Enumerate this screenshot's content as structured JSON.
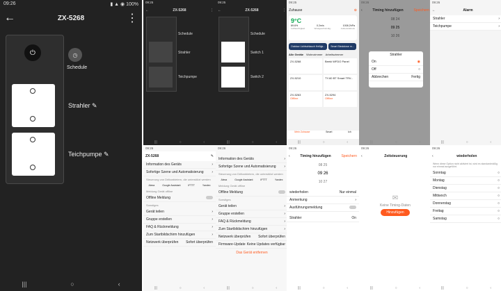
{
  "big": {
    "time": "09:26",
    "title": "ZX-5268",
    "schedule": "Schedule",
    "switch1": "Strahler",
    "switch2": "Teichpumpe"
  },
  "p1": {
    "time": "09:25",
    "title": "ZX-5268",
    "schedule": "Schedule",
    "s1": "Strahler",
    "s2": "Teichpumpe"
  },
  "p2": {
    "time": "09:25",
    "title": "ZX-5268",
    "schedule": "Schedule",
    "s1": "Switch 1",
    "s2": "Switch 2"
  },
  "p3": {
    "time": "09:25",
    "home": "Zuhause",
    "temp": "9°C",
    "hum": "69.6%",
    "hum_l": "Luftfeuchtigkeit",
    "pm": "0.2m/s",
    "pm_l": "Windgeschwindig..",
    "pr": "1008.2hPa",
    "pr_l": "Außenluftdruck",
    "scene1": "Outdoor Lichtschlauch Helligk...",
    "scene2": "Smart Steckdose m...",
    "tabs": [
      "Alle Geräte",
      "Wohnzimmer",
      "Arbeitszimmer"
    ],
    "devices": [
      "ZX-5268",
      "Beeki WFDO Panel",
      "ZX-5210",
      "TY-60 BT Smart TRV...",
      "ZX-5263",
      "ZX-5294"
    ],
    "offline": "Offline",
    "nav": [
      "Mein Zuhause",
      "Smart",
      "Ich"
    ]
  },
  "p4": {
    "time": "09:26",
    "title": "Timing hinzufügen",
    "save": "Speichern",
    "times": [
      "08 24",
      "09 25",
      "10 26"
    ],
    "dlg": "Strahler",
    "on": "On",
    "off": "Off",
    "cancel": "Abbrechen",
    "done": "Fertig"
  },
  "p5": {
    "time": "09:26",
    "title": "Alarm",
    "items": [
      "Strahler",
      "Teichpumpe"
    ]
  },
  "p6": {
    "time": "09:26",
    "title": "ZX-5268",
    "i1": "Information des Geräts",
    "i2": "Sofortige Szene und Automatisierung",
    "third": "Steuerung von Drittanbietern, die unterstützt werden",
    "tp": [
      "Alexa",
      "Google Assistant",
      "IFTTT",
      "Yandex"
    ],
    "off_l": "Meldung Gerät offline",
    "off": "Offline Meldung",
    "sonst": "Sonstiges",
    "rows": [
      "Gerät teilen",
      "Gruppe erstellen",
      "FAQ & Rückmeldung",
      "Zum Startbildschirm hinzufügen",
      "Netzwerk überprüfen"
    ],
    "check": "Sofort überprüfen"
  },
  "p7": {
    "time": "09:26",
    "i1": "Information des Geräts",
    "i2": "Sofortige Szene und Automatisierung",
    "third": "Steuerung von Drittanbietern, die unterstützt werden",
    "tp": [
      "Alexa",
      "Google Assistant",
      "IFTTT",
      "Yandex"
    ],
    "off_l": "Meldung Gerät offline",
    "off": "Offline Meldung",
    "sonst": "Sonstiges",
    "rows": [
      "Gerät teilen",
      "Gruppe erstellen",
      "FAQ & Rückmeldung",
      "Zum Startbildschirm hinzufügen",
      "Netzwerk überprüfen",
      "Firmware-Update"
    ],
    "check": "Sofort überprüfen",
    "fw": "Keine Updates verfügbar",
    "remove": "Das Gerät entfernen"
  },
  "p8": {
    "time": "09:26",
    "title": "Timing hinzufügen",
    "save": "Speichern",
    "times": [
      "08 25",
      "09 26",
      "10 27"
    ],
    "rep": "wiederholen",
    "rep_v": "Nur einmal",
    "note": "Anmerkung",
    "ausf": "Ausführungsmeldung",
    "strahler": "Strahler",
    "on": "On"
  },
  "p9": {
    "time": "09:26",
    "title": "Zeitsteuerung",
    "empty": "Keine Timing-Daten",
    "add": "Hinzufügen"
  },
  "p10": {
    "time": "09:26",
    "title": "wiederholen",
    "hint": "Wenn diese Option nicht aktiviert ist, wird es standardmäßig nur einmal ausgeführt.",
    "days": [
      "Sonntag",
      "Montag",
      "Dienstag",
      "Mittwoch",
      "Donnerstag",
      "Freitag",
      "Samstag"
    ]
  }
}
